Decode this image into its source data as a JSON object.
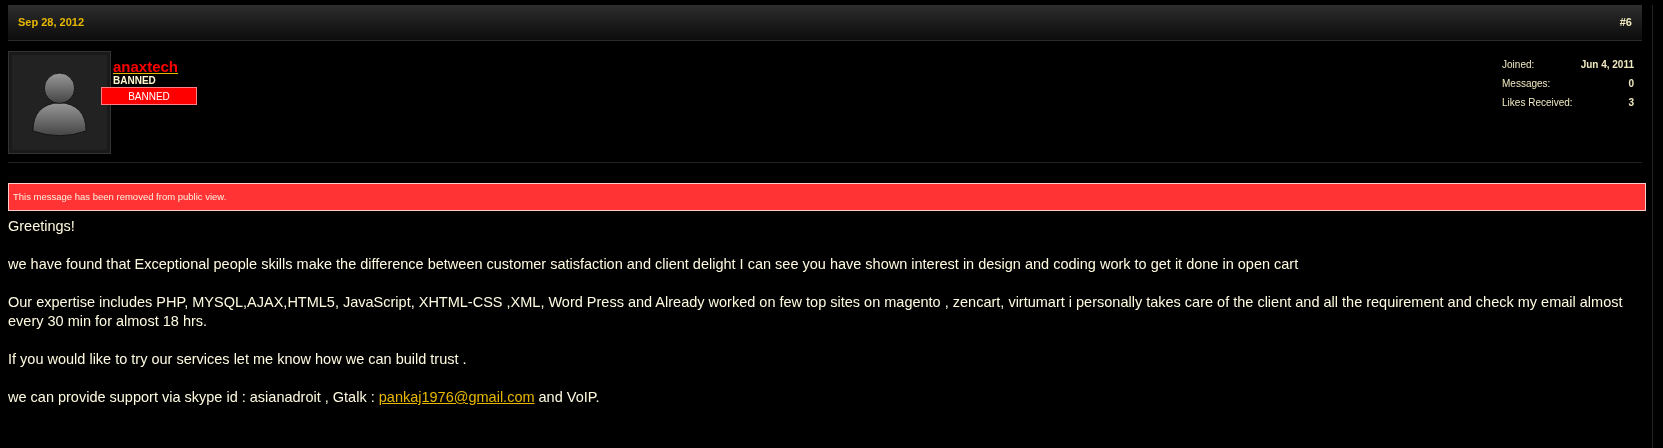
{
  "post": {
    "date": "Sep 28, 2012",
    "number": "#6"
  },
  "user": {
    "name": "anaxtech",
    "title": "BANNED",
    "banner": "BANNED",
    "stats": [
      {
        "label": "Joined:",
        "value": "Jun 4, 2011"
      },
      {
        "label": "Messages:",
        "value": "0"
      },
      {
        "label": "Likes Received:",
        "value": "3"
      }
    ]
  },
  "notice": "This message has been removed from public view.",
  "message": [
    {
      "kind": "text",
      "text": "Greetings!"
    },
    {
      "kind": "text",
      "text": "we have found that Exceptional people skills make the difference between customer satisfaction and client delight I can see you have shown interest in design and coding work to get it done in open cart"
    },
    {
      "kind": "text",
      "text": "Our expertise includes PHP, MYSQL,AJAX,HTML5, JavaScript, XHTML-CSS ,XML, Word Press and Already worked on few top sites on magento , zencart, virtumart i personally takes care of the client and all the requirement and check my email almost every 30 min for almost 18 hrs."
    },
    {
      "kind": "text",
      "text": "If you would like to try our services let me know how we can build trust ."
    },
    {
      "kind": "link",
      "before": "we can provide support via skype id : asianadroit , Gtalk : ",
      "link": "pankaj1976@gmail.com",
      "after": " and VoIP."
    }
  ]
}
